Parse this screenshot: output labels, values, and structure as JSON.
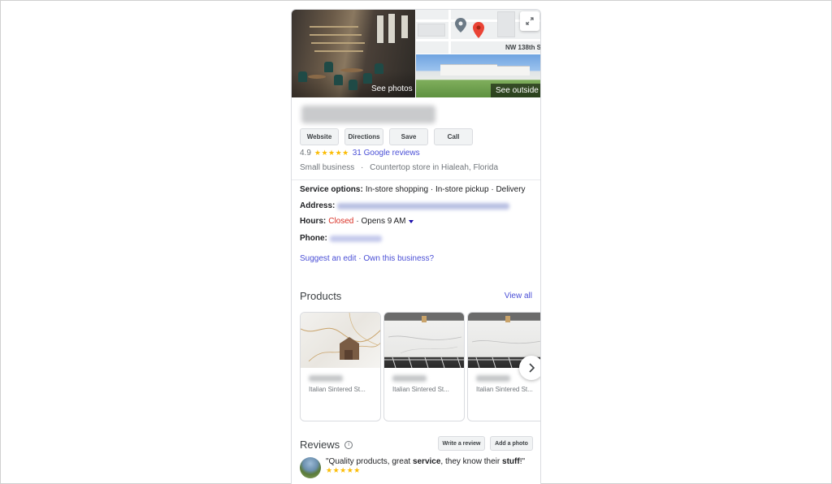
{
  "photos": {
    "see_photos": "See photos",
    "see_outside": "See outside",
    "map_street": "NW 138th S"
  },
  "actions": {
    "website": "Website",
    "directions": "Directions",
    "save": "Save",
    "call": "Call"
  },
  "rating": {
    "value": "4.9",
    "stars": "★★★★★",
    "reviews_link": "31 Google reviews"
  },
  "category": {
    "type": "Small business",
    "separator": "·",
    "desc": "Countertop store in Hialeah, Florida"
  },
  "info": {
    "service_label": "Service options:",
    "service_value": "In-store shopping · In-store pickup · Delivery",
    "address_label": "Address:",
    "hours_label": "Hours:",
    "hours_status": "Closed",
    "hours_next": "· Opens 9 AM",
    "phone_label": "Phone:"
  },
  "links": {
    "suggest_edit": "Suggest an edit",
    "own_business": "Own this business?",
    "separator": " · "
  },
  "products": {
    "title": "Products",
    "view_all": "View all",
    "items": [
      {
        "subtitle": "Italian Sintered St..."
      },
      {
        "subtitle": "Italian Sintered St..."
      },
      {
        "subtitle": "Italian Sintered St..."
      }
    ]
  },
  "reviews": {
    "title": "Reviews",
    "write_review": "Write a review",
    "add_photo": "Add a photo",
    "snippet": {
      "before": "\"Quality products, great ",
      "bold1": "service",
      "middle": ", they know their ",
      "bold2": "stuff",
      "after": "!\"",
      "stars": "★★★★★"
    }
  },
  "colors": {
    "link": "#1a0dab",
    "closed": "#d93025",
    "star": "#fbbc04"
  }
}
